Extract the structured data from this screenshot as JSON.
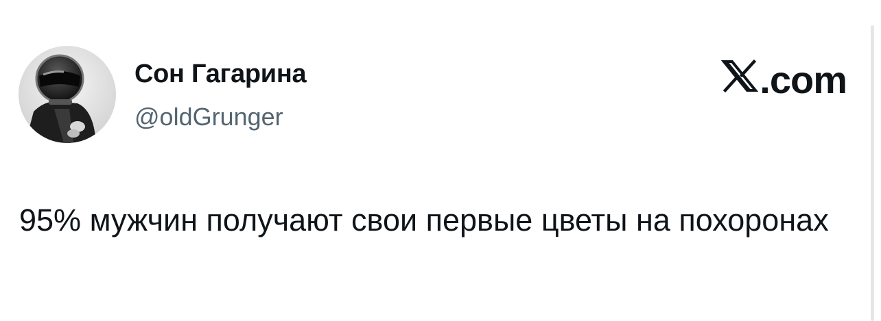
{
  "author": {
    "display_name": "Сон Гагарина",
    "handle": "@oldGrunger",
    "avatar_icon": "astronaut-avatar"
  },
  "brand": {
    "label": ".com",
    "icon": "x-logo-icon"
  },
  "tweet": {
    "text": "95% мужчин получают свои первые цветы на похоронах"
  },
  "colors": {
    "text": "#0f1419",
    "secondary_text": "#536471",
    "background": "#ffffff"
  }
}
